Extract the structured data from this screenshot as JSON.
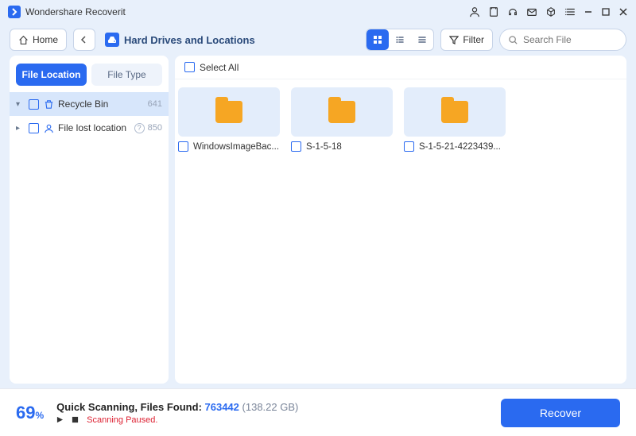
{
  "app": {
    "title": "Wondershare Recoverit"
  },
  "toolbar": {
    "home_label": "Home",
    "location_label": "Hard Drives and Locations",
    "filter_label": "Filter",
    "search_placeholder": "Search File"
  },
  "sidebar": {
    "tabs": {
      "file_location": "File Location",
      "file_type": "File Type"
    },
    "items": [
      {
        "label": "Recycle Bin",
        "count": "641"
      },
      {
        "label": "File lost location",
        "count": "850"
      }
    ]
  },
  "content": {
    "select_all": "Select All",
    "folders": [
      {
        "name": "WindowsImageBac..."
      },
      {
        "name": "S-1-5-18"
      },
      {
        "name": "S-1-5-21-4223439..."
      }
    ]
  },
  "footer": {
    "percent": "69",
    "percent_suffix": "%",
    "status_prefix": "Quick Scanning, Files Found: ",
    "found": "763442",
    "size": "(138.22 GB)",
    "paused": "Scanning Paused.",
    "recover_label": "Recover"
  }
}
